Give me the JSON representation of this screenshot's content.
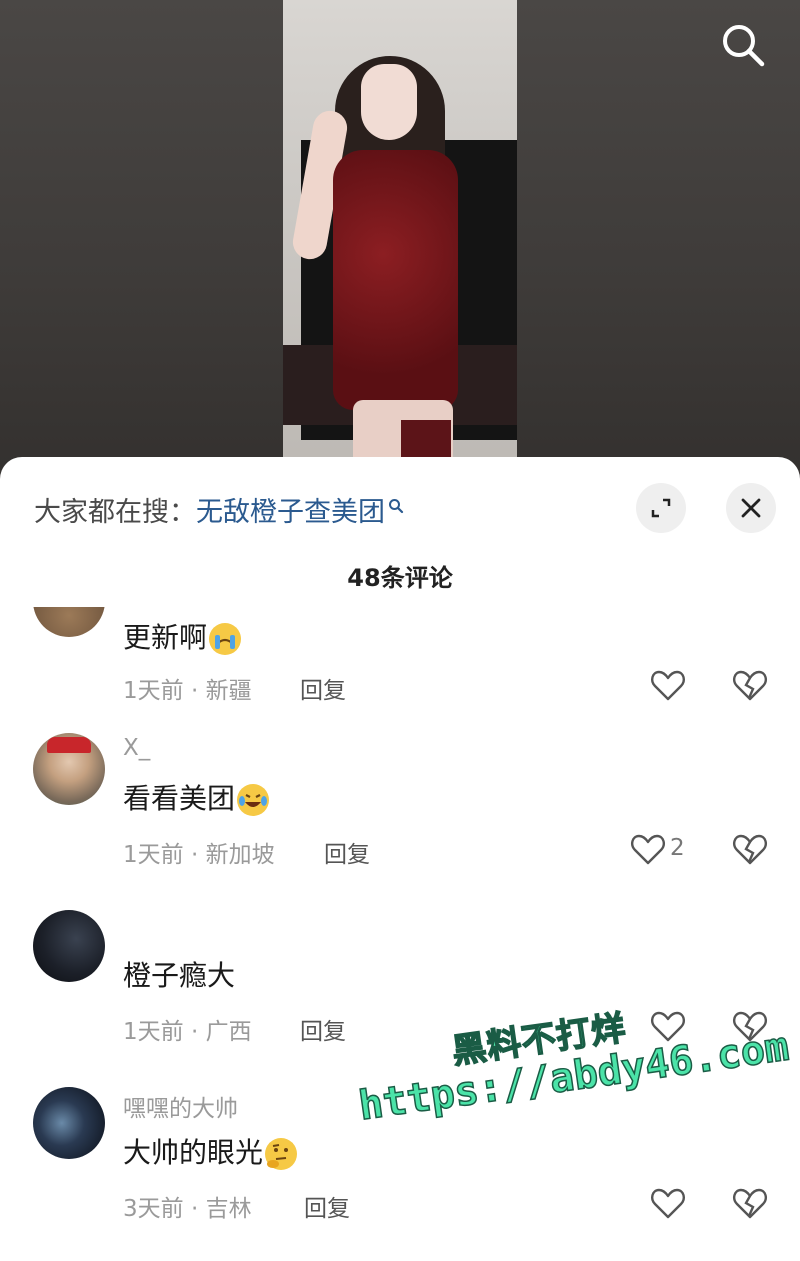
{
  "search_bar": {
    "prefix": "大家都在搜：",
    "query": "无敌橙子查美团"
  },
  "comment_count": "48条评论",
  "comments": [
    {
      "username": "",
      "text": "更新啊",
      "emoji": "crying-face-emoji",
      "meta": "1天前 · 新疆",
      "reply": "回复",
      "likes": ""
    },
    {
      "username": "X_",
      "text": "看看美团",
      "emoji": "laughing-tears-emoji",
      "meta": "1天前 · 新加坡",
      "reply": "回复",
      "likes": "2"
    },
    {
      "username": "",
      "text": "橙子瘾大",
      "emoji": "",
      "meta": "1天前 · 广西",
      "reply": "回复",
      "likes": ""
    },
    {
      "username": "嘿嘿的大帅",
      "text": "大帅的眼光",
      "emoji": "thinking-face-emoji",
      "meta": "3天前 · 吉林",
      "reply": "回复",
      "likes": ""
    }
  ],
  "watermark": {
    "line1": "黑料不打烊",
    "line2": "https://abdy46.com"
  },
  "colors": {
    "link": "#2b5a8f",
    "watermark": "#4be3a8",
    "dress": "#7a1a1f"
  }
}
